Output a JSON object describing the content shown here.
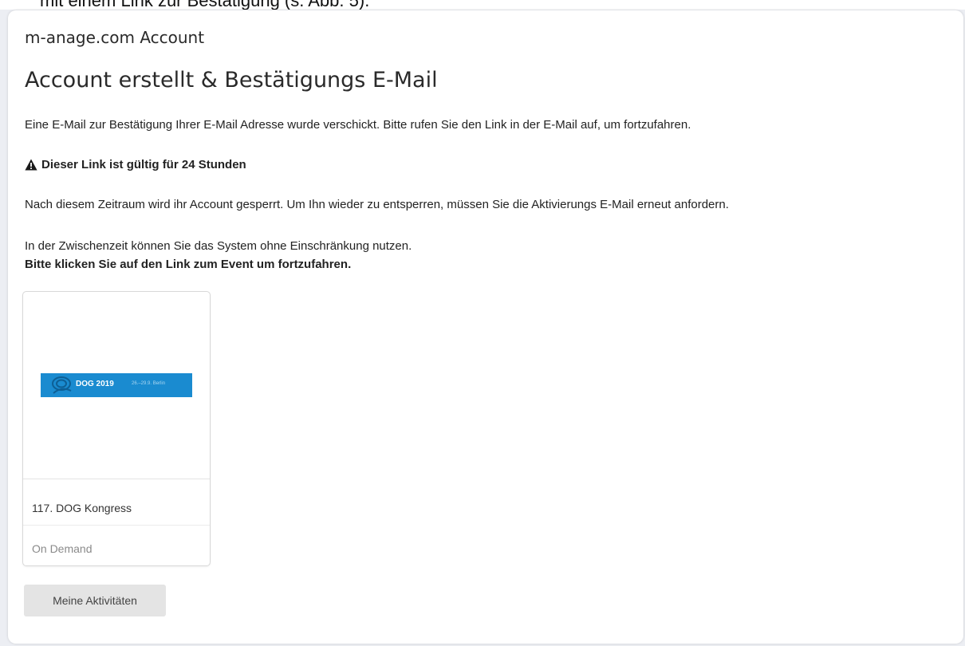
{
  "context": {
    "clipped_text": "mit einem Link zur Bestätigung (s. Abb. 5)."
  },
  "header": {
    "app_title": "m-anage.com Account",
    "page_title": "Account erstellt & Bestätigungs E-Mail"
  },
  "main": {
    "intro": "Eine E-Mail zur Bestätigung Ihrer E-Mail Adresse wurde verschickt. Bitte rufen Sie den Link in der E-Mail auf, um fortzufahren.",
    "warning": "Dieser Link ist gültig für 24 Stunden",
    "lock_notice": "Nach diesem Zeitraum wird ihr Account gesperrt. Um Ihn wieder zu entsperren, müssen Sie die Aktivierungs E-Mail erneut anfordern.",
    "meantime": "In der Zwischenzeit können Sie das System ohne Einschränkung nutzen.",
    "instruction": "Bitte klicken Sie auf den Link zum Event um fortzufahren."
  },
  "event": {
    "banner_title": "DOG 2019",
    "banner_subtitle": "26.–29.9. Berlin",
    "name": "117. DOG Kongress",
    "status": "On Demand"
  },
  "actions": {
    "activities_label": "Meine Aktivitäten"
  },
  "colors": {
    "banner": "#1a8bd0",
    "button_bg": "#e4e4e4",
    "page_bg": "#eceef3"
  },
  "icons": {
    "warning": "warning-triangle-icon",
    "banner_logo": "dog-swirl-logo-icon"
  }
}
